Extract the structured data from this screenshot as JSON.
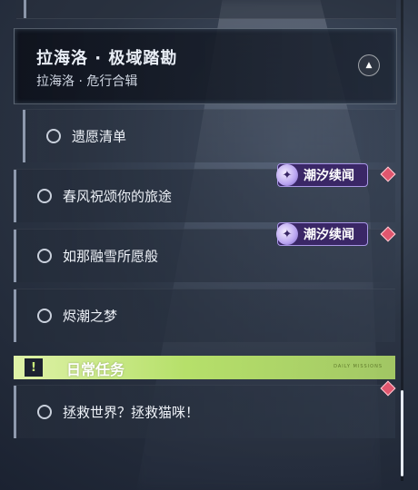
{
  "header": {
    "title": "拉海洛 · 极域踏勘",
    "subtitle": "拉海洛 · 危行合辑",
    "collapse_icon": "chevron-up-icon"
  },
  "quests": [
    {
      "label": "遗愿清单",
      "tag": null
    },
    {
      "label": "春风祝颂你的旅途",
      "tag": "潮汐续闻"
    },
    {
      "label": "如那融雪所愿般",
      "tag": "潮汐续闻"
    },
    {
      "label": "烬潮之梦",
      "tag": null
    }
  ],
  "daily_section": {
    "title": "日常任务",
    "icon": "notice-icon",
    "badge": "DAILY MISSIONS"
  },
  "daily_quests": [
    {
      "label": "拯救世界？拯救猫咪！"
    }
  ],
  "colors": {
    "accent_green": "#b6e06a",
    "event_tag_bg": "#3a2766",
    "alert_diamond": "#e0566e"
  }
}
